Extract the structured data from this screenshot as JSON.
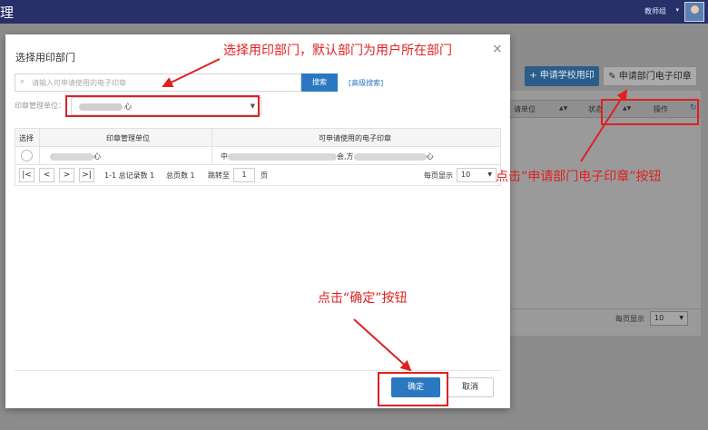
{
  "topbar": {
    "title": "理",
    "user_name": "教师组",
    "caret": "▾"
  },
  "background": {
    "btn_school": "+ 申请学校用印",
    "btn_dept": "✎ 申请部门电子印章",
    "header_unit": "请单位",
    "header_status": "状态",
    "header_action": "操作",
    "footer_per_page": "每页显示",
    "footer_per_page_value": "10"
  },
  "modal": {
    "title": "选择用印部门",
    "close": "×",
    "search_placeholder": "请输入可申请使用的电子印章",
    "search_button": "搜索",
    "advanced_search": "[高级搜索]",
    "unit_label": "印章管理单位：",
    "unit_value_suffix": "心",
    "table": {
      "headers": [
        "选择",
        "印章管理单位",
        "可申请使用的电子印章"
      ],
      "rows": [
        {
          "unit_suffix": "心",
          "seal_prefix": "中",
          "seal_mid": "会,方",
          "seal_suffix": "心"
        }
      ]
    },
    "pager": {
      "first": "|<",
      "prev": "<",
      "next": ">",
      "last": ">|",
      "records": "1-1 总记录数 1",
      "pages": "总页数 1",
      "jump_to": "跳转至",
      "page_value": "1",
      "page_unit": "页",
      "per_page": "每页显示",
      "per_page_value": "10"
    },
    "ok_button": "确定",
    "cancel_button": "取消"
  },
  "annotations": {
    "select_dept": "选择用印部门，默认部门为用户所在部门",
    "click_apply": "点击“申请部门电子印章”按钮",
    "click_ok": "点击“确定”按钮"
  },
  "colors": {
    "topbar": "#28306a",
    "primary": "#2b78c2",
    "annotation": "#e02020"
  }
}
